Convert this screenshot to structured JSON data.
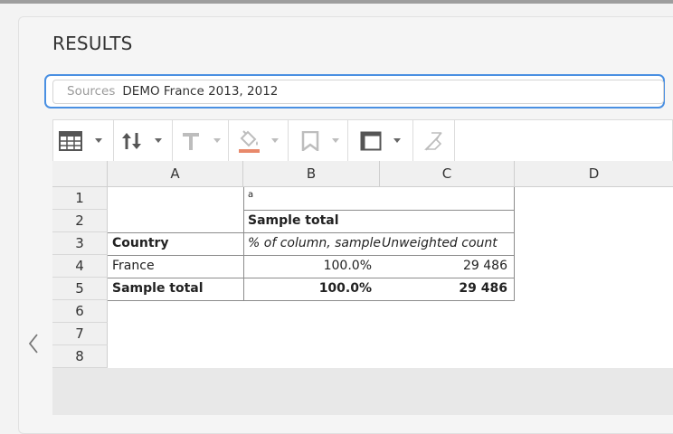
{
  "page": {
    "title": "RESULTS"
  },
  "sources": {
    "label": "Sources",
    "value": "DEMO France 2013, 2012"
  },
  "toolbar": {
    "icons": [
      "table-icon",
      "sort-icon",
      "text-format-icon",
      "fill-color-icon",
      "bookmark-icon",
      "border-icon",
      "clear-format-icon"
    ],
    "fill_color": "#e8896b"
  },
  "sheet": {
    "columns": [
      "A",
      "B",
      "C",
      "D"
    ],
    "rows": [
      "1",
      "2",
      "3",
      "4",
      "5",
      "6",
      "7",
      "8"
    ],
    "cells": {
      "b1": "a",
      "b2": "Sample total",
      "a3": "Country",
      "b3": "% of column, sample",
      "c3": "Unweighted count",
      "a4": "France",
      "b4": "100.0%",
      "c4": "29 486",
      "a5": "Sample total",
      "b5": "100.0%",
      "c5": "29 486"
    }
  },
  "colors": {
    "focus_ring": "#4a90e2",
    "grid_border": "#8c8c8c"
  }
}
